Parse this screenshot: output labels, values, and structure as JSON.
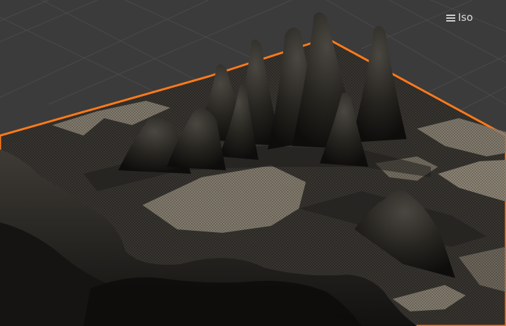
{
  "viewport": {
    "view_label": "Iso",
    "menu_icon": "hamburger-menu-icon",
    "colors": {
      "background": "#3b3b3b",
      "grid_line": "#4a4a4a",
      "terrain_base": "#2d2b28",
      "terrain_dark": "#1a1918",
      "mesh_light": "#8c8475",
      "selection_outline": "#ff7a1a"
    }
  }
}
